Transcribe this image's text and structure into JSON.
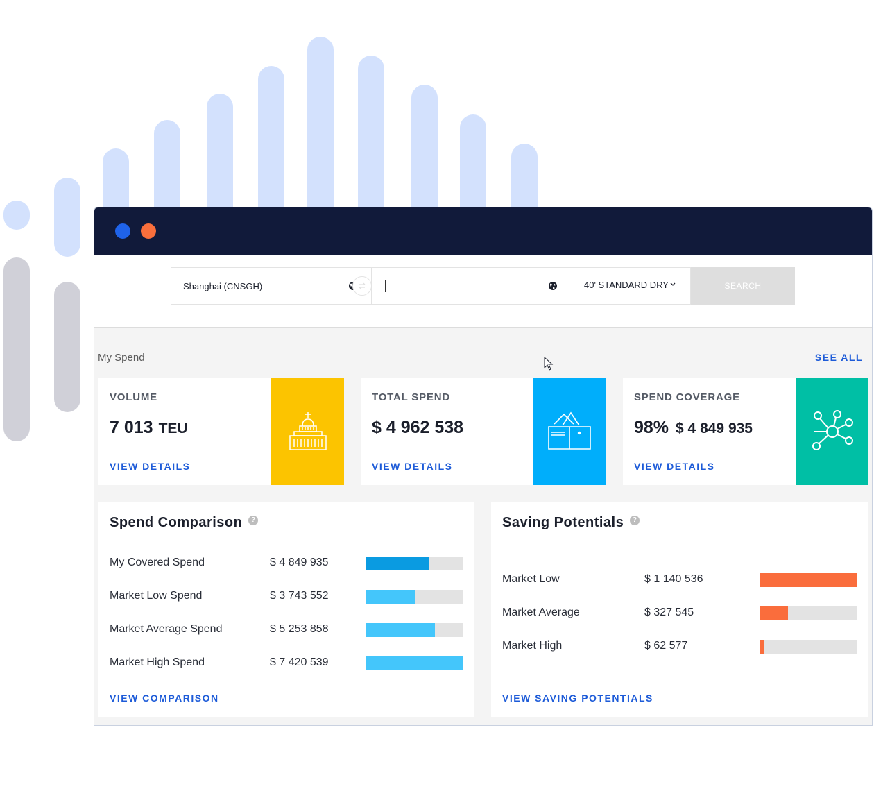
{
  "colors": {
    "pill_blue": "#d3e1fd",
    "pill_gray": "#d0d0d8",
    "titlebar": "#111a3a",
    "dot_blue": "#1f63ea",
    "dot_orange": "#f96f3c",
    "volume_tile": "#fcc400",
    "spend_tile": "#00aefb",
    "coverage_tile": "#00bfa5",
    "bar_dark_blue": "#0a9be1",
    "bar_light_blue": "#44c6fb",
    "bar_orange": "#fa6d3c",
    "link_blue": "#1d5bd8"
  },
  "search": {
    "origin_value": "Shanghai (CNSGH)",
    "destination_value": "",
    "container_label": "40' STANDARD DRY",
    "search_label": "SEARCH"
  },
  "my_spend": {
    "title": "My Spend",
    "see_all": "SEE ALL",
    "cards": [
      {
        "label": "VOLUME",
        "value": "7 013",
        "unit": "TEU",
        "link": "VIEW DETAILS",
        "icon": "building-icon"
      },
      {
        "label": "TOTAL SPEND",
        "value": "$ 4 962 538",
        "link": "VIEW DETAILS",
        "icon": "wallet-icon"
      },
      {
        "label": "SPEND COVERAGE",
        "value": "98%",
        "sub_value": "$ 4 849 935",
        "link": "VIEW DETAILS",
        "icon": "network-icon"
      }
    ]
  },
  "spend_comparison": {
    "title": "Spend Comparison",
    "help": "?",
    "rows": [
      {
        "label": "My Covered Spend",
        "value": "$ 4 849 935",
        "fill": 0.65,
        "color": "#0a9be1"
      },
      {
        "label": "Market Low Spend",
        "value": "$ 3 743 552",
        "fill": 0.5,
        "color": "#44c6fb"
      },
      {
        "label": "Market Average Spend",
        "value": "$ 5 253 858",
        "fill": 0.71,
        "color": "#44c6fb"
      },
      {
        "label": "Market High Spend",
        "value": "$ 7 420 539",
        "fill": 1.0,
        "color": "#44c6fb"
      }
    ],
    "link": "VIEW COMPARISON"
  },
  "saving_potentials": {
    "title": "Saving Potentials",
    "help": "?",
    "rows": [
      {
        "label": "Market Low",
        "value": "$ 1 140 536",
        "fill": 1.0,
        "color": "#fa6d3c"
      },
      {
        "label": "Market Average",
        "value": "$ 327 545",
        "fill": 0.29,
        "color": "#fa6d3c"
      },
      {
        "label": "Market High",
        "value": "$ 62 577",
        "fill": 0.05,
        "color": "#fa6d3c"
      }
    ],
    "link": "VIEW SAVING POTENTIALS"
  }
}
